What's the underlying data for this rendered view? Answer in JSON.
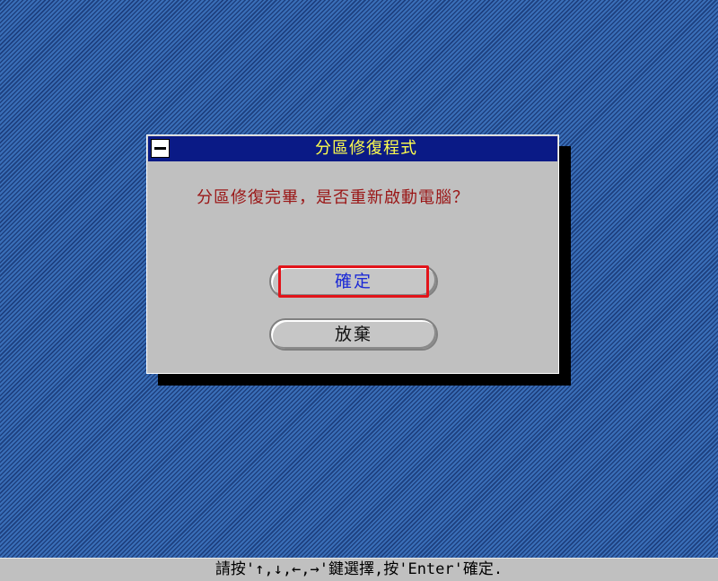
{
  "dialog": {
    "title": "分區修復程式",
    "message": "分區修復完畢，是否重新啟動電腦？",
    "buttons": {
      "confirm_label": "確定",
      "cancel_label": "放棄"
    },
    "focused_button": "confirm"
  },
  "statusbar": {
    "hint": "請按'↑,↓,←,→'鍵選擇,按'Enter'確定."
  },
  "colors": {
    "desktop": "#2a5fa3",
    "titlebar": "#0a1a86",
    "title_text": "#ffff4d",
    "message_text": "#9a1616",
    "confirm_text": "#1c2ad6",
    "focus_ring": "#e2141a",
    "dialog_bg": "#c0c0c0"
  },
  "icons": {
    "system_menu": "minus-box-icon"
  }
}
